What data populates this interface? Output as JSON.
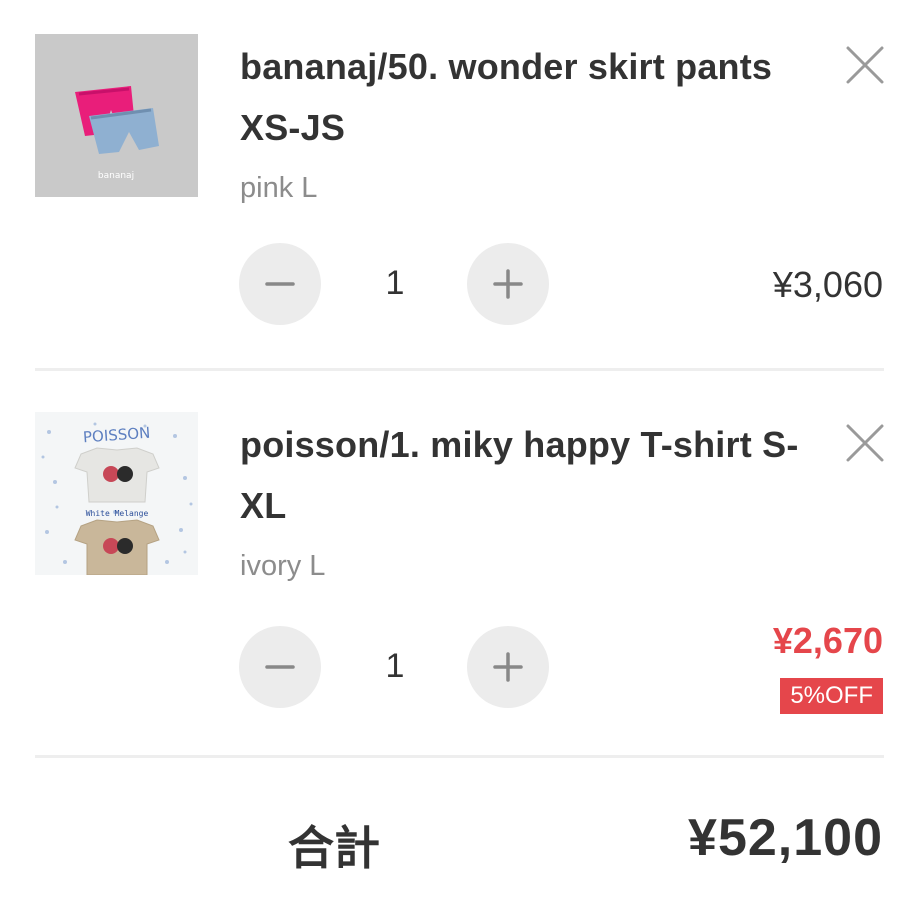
{
  "cart": {
    "items": [
      {
        "title": "bananaj/50. wonder skirt pants XS-JS",
        "variant": "pink L",
        "quantity": "1",
        "price": "¥3,060",
        "thumb_caption": "bananaj",
        "colors": {
          "product_a": "#e91e7a",
          "product_b": "#8fb0d1"
        }
      },
      {
        "title": "poisson/1. miky happy T-shirt S-XL",
        "variant": "ivory L",
        "quantity": "1",
        "price": "¥2,670",
        "discount": "5%OFF",
        "thumb_brand": "POISSON",
        "thumb_caption": "White Melange",
        "colors": {
          "product_a": "#e6e6e3",
          "product_b": "#c9b79a"
        }
      }
    ],
    "total": {
      "label": "合計",
      "value": "¥52,100"
    }
  },
  "icons": {
    "remove": "close-icon",
    "decrement": "minus-icon",
    "increment": "plus-icon"
  },
  "theme": {
    "text": "#333333",
    "muted": "#8c8c8c",
    "sale": "#e5464b",
    "stepper_bg": "#ececec"
  }
}
